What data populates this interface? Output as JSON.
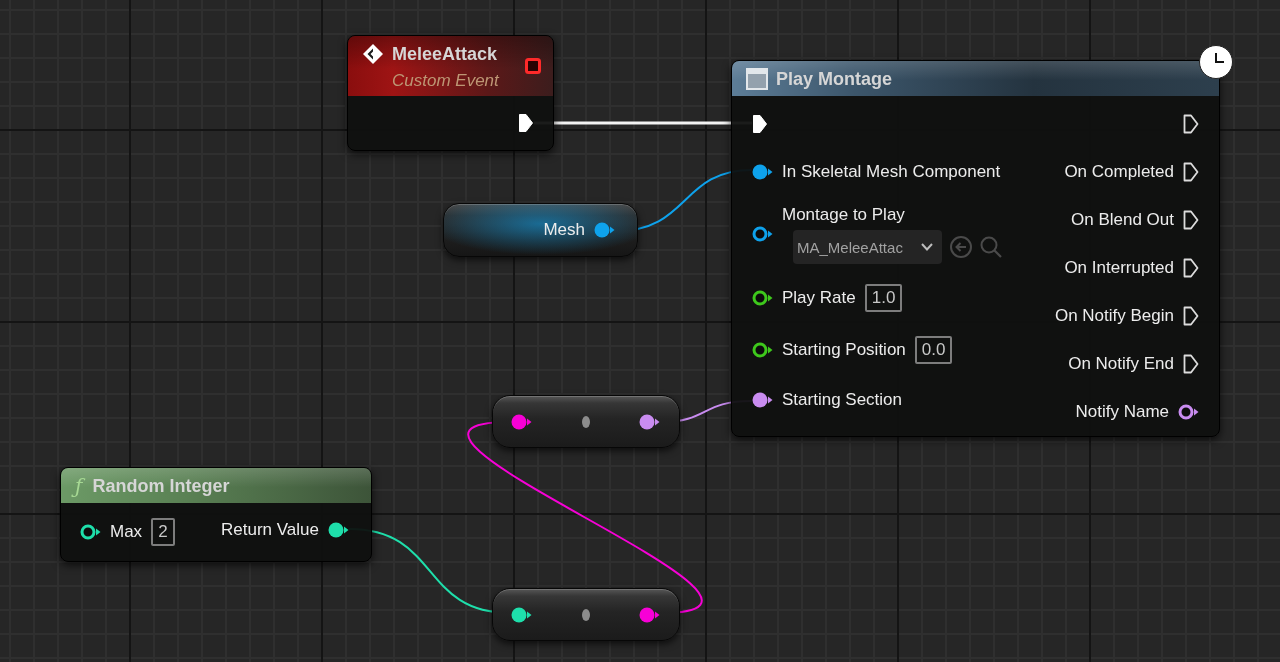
{
  "graph": {
    "nodes": [
      {
        "kind": "custom_event",
        "title": "MeleeAttack",
        "subtitle": "Custom Event",
        "delegate_pin": {
          "connected": false
        },
        "outputs": [
          {
            "kind": "exec",
            "connected": true
          }
        ]
      },
      {
        "kind": "async_action",
        "title": "Play Montage",
        "latent": true,
        "inputs": [
          {
            "kind": "exec",
            "connected": true
          },
          {
            "kind": "data",
            "label": "In Skeletal Mesh Component",
            "color": "#0ea2ec",
            "connected": true
          },
          {
            "kind": "asset",
            "label": "Montage to Play",
            "color": "#0ea2ec",
            "connected": false,
            "value": "MA_MeleeAttac"
          },
          {
            "kind": "data",
            "label": "Play Rate",
            "color": "#3ec81c",
            "connected": false,
            "value": "1.0"
          },
          {
            "kind": "data",
            "label": "Starting Position",
            "color": "#3ec81c",
            "connected": false,
            "value": "0.0"
          },
          {
            "kind": "data",
            "label": "Starting Section",
            "color": "#c98cf0",
            "connected": true
          }
        ],
        "outputs": [
          {
            "kind": "exec",
            "connected": false
          },
          {
            "kind": "exec",
            "label": "On Completed",
            "connected": false
          },
          {
            "kind": "exec",
            "label": "On Blend Out",
            "connected": false
          },
          {
            "kind": "exec",
            "label": "On Interrupted",
            "connected": false
          },
          {
            "kind": "exec",
            "label": "On Notify Begin",
            "connected": false
          },
          {
            "kind": "exec",
            "label": "On Notify End",
            "connected": false
          },
          {
            "kind": "data",
            "label": "Notify Name",
            "color": "#c98cf0",
            "connected": false
          }
        ]
      },
      {
        "kind": "variable_get",
        "label": "Mesh",
        "outputs": [
          {
            "kind": "data",
            "color": "#0ea2ec",
            "connected": true
          }
        ]
      },
      {
        "kind": "conversion",
        "inputs": [
          {
            "kind": "data",
            "color": "#f700d6",
            "connected": true
          }
        ],
        "outputs": [
          {
            "kind": "data",
            "color": "#c98cf0",
            "connected": true
          }
        ]
      },
      {
        "kind": "pure_function",
        "icon_glyph": "ƒ",
        "title": "Random Integer",
        "inputs": [
          {
            "kind": "data",
            "label": "Max",
            "color": "#1edfab",
            "connected": false,
            "value": "2"
          }
        ],
        "outputs": [
          {
            "kind": "data",
            "label": "Return Value",
            "color": "#1edfab",
            "connected": true
          }
        ]
      },
      {
        "kind": "conversion",
        "inputs": [
          {
            "kind": "data",
            "color": "#1edfab",
            "connected": true
          }
        ],
        "outputs": [
          {
            "kind": "data",
            "color": "#f700d6",
            "connected": true
          }
        ]
      }
    ]
  }
}
